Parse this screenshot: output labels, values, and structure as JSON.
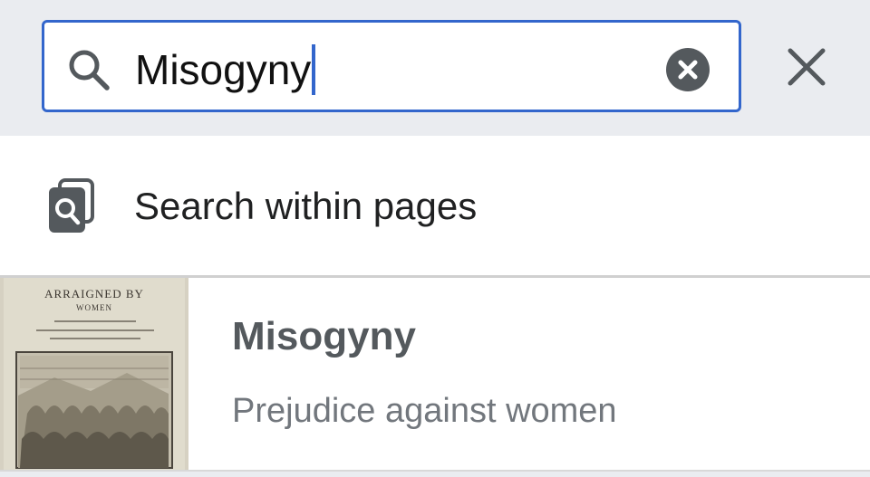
{
  "search": {
    "query": "Misogyny"
  },
  "suggestions": {
    "search_within_label": "Search within pages"
  },
  "results": [
    {
      "title": "Misogyny",
      "description": "Prejudice against women",
      "thumbnail": {
        "lines": [
          "ARRAIGNED BY",
          "WOMEN"
        ]
      }
    }
  ],
  "colors": {
    "accent": "#3366cc",
    "topbar_bg": "#eaecf0",
    "icon_gray": "#54595d"
  }
}
